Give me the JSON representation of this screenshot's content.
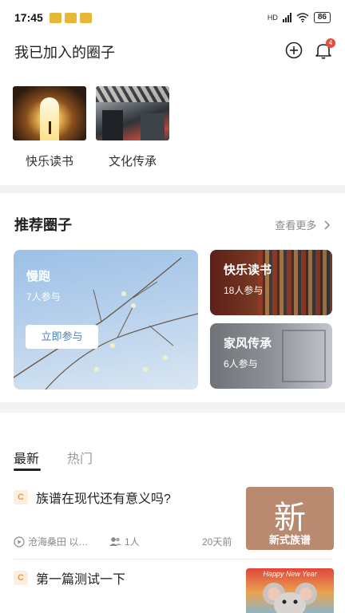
{
  "status_bar": {
    "time": "17:45",
    "battery": "86",
    "network": "HD"
  },
  "header": {
    "title": "我已加入的圈子"
  },
  "notifications": {
    "count": "4"
  },
  "joined_circles": [
    {
      "label": "快乐读书"
    },
    {
      "label": "文化传承"
    }
  ],
  "recommended": {
    "title": "推荐圈子",
    "see_more": "查看更多",
    "cards": [
      {
        "name": "慢跑",
        "count": "7人参与",
        "join_label": "立即参与"
      },
      {
        "name": "快乐读书",
        "count": "18人参与"
      },
      {
        "name": "家风传承",
        "count": "6人参与"
      }
    ]
  },
  "feed": {
    "tabs": [
      "最新",
      "热门"
    ],
    "posts": [
      {
        "title": "族谱在现代还有意义吗?",
        "author": "沧海桑田 以…",
        "members": "1人",
        "time": "20天前",
        "thumb_char": "新",
        "thumb_caption": "新式族谱"
      },
      {
        "title": "第一篇测试一下",
        "thumb_caption": "Happy New Year"
      }
    ]
  }
}
